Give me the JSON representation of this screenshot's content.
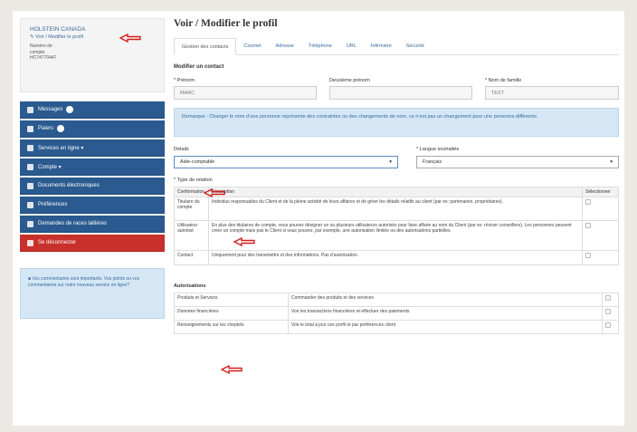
{
  "account": {
    "name": "HOLSTEIN CANADA",
    "link": "Voir / Modifier le profil",
    "lines": [
      "Numéro de",
      "compte",
      "HC74770447"
    ]
  },
  "nav": [
    {
      "label": "Messages",
      "badge": true,
      "icon": "envelope-icon"
    },
    {
      "label": "Paiers",
      "badge": true,
      "icon": "flag-icon"
    },
    {
      "label": "Services en ligne ▾",
      "badge": false,
      "icon": "pencil-icon"
    },
    {
      "label": "Compte ▾",
      "badge": false,
      "icon": "calendar-icon"
    },
    {
      "label": "Documents électroniques",
      "badge": false,
      "icon": "folder-icon"
    },
    {
      "label": "Préférences",
      "badge": false,
      "icon": "star-icon"
    },
    {
      "label": "Demandes de races laitières",
      "badge": false,
      "icon": "document-icon"
    },
    {
      "label": "Se déconnecter",
      "badge": false,
      "icon": "power-icon",
      "danger": true
    }
  ],
  "info_box": "■ Vos commentaires sont importants. Vos points ou vos commentaires sur notre nouveau service en ligne?",
  "page_title": "Voir / Modifier le profil",
  "tabs": [
    "Gestion des contacts",
    "Courriel",
    "Adresse",
    "Téléphone",
    "URL",
    "Infirmière",
    "Sécurité"
  ],
  "form": {
    "section": "Modifier un contact",
    "prenom_label": "* Prénom",
    "prenom_value": "MARC",
    "deuxieme_label": "Deuxième prénom",
    "deuxieme_value": "",
    "nom_label": "* Nom de famille",
    "nom_value": "TEST",
    "alert": "Remarque : Changer le nom d’une personne représente des contraintes ou des changements de nom, ce n’est pas un changement pour une personne différente.",
    "details_label": "Détails",
    "details_value": "Aide-comptable",
    "langue_label": "* Langue souhaitée",
    "langue_value": "Français"
  },
  "relation": {
    "label": "* Type de relation",
    "headers": [
      "Conformation",
      "Description",
      "Sélectionner"
    ],
    "rows": [
      {
        "name": "Titulaire du compte",
        "desc": "Individus responsables du Client et de la pleine activité de leurs affaires et de gérer les détails relatifs au client (par ex: partenaires, propriétaires)."
      },
      {
        "name": "Utilisateur autorisé",
        "desc": "En plus des titulaires de compte, vous pouvez désigner un ou plusieurs utilisateurs autorisés pour faire affaire au nom du Client (par ex: réviser conseillers). Les personnes peuvent créer un compte mais pas le Client si vous pouvez, par exemple, une autorisation limitée ou des autorisations partielles."
      },
      {
        "name": "Contact",
        "desc": "Uniquement pour des transmettre et des informations. Pas d’autorisation."
      }
    ]
  },
  "autorisations": {
    "label": "Autorisations",
    "rows": [
      {
        "name": "Produits et Services",
        "desc": "Commander des produits et des services"
      },
      {
        "name": "Données financières",
        "desc": "Voir les transactions financières et effectuer des paiements"
      },
      {
        "name": "Renseignements sur les cheptels",
        "desc": "Voir le total à jour ces profil et par préférences client"
      }
    ]
  },
  "colors": {
    "nav_blue": "#2a5a8f",
    "danger_red": "#c7302b",
    "arrow_red": "#d21f1f",
    "link_blue": "#3a6a9a"
  }
}
